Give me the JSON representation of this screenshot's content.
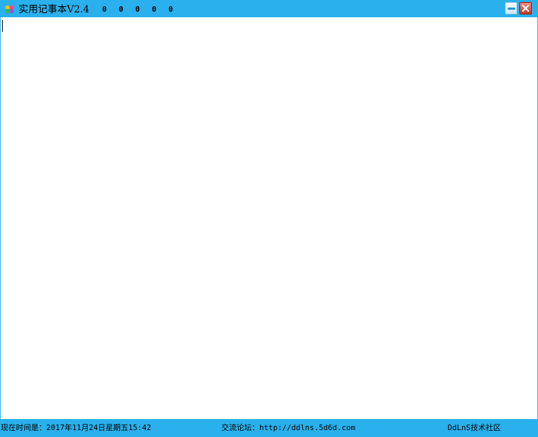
{
  "window": {
    "title": "实用记事本V2.4",
    "menu_items": [
      "0",
      "0",
      "0",
      "0",
      "0"
    ],
    "accent_color": "#2ab0ec",
    "icons": {
      "app": "app-logo-icon",
      "minimize": "minimize-icon",
      "close": "close-icon"
    }
  },
  "editor": {
    "content": ""
  },
  "statusbar": {
    "time_label": "现在时间是：2017年11月24日星期五15:42",
    "forum_label": "交流论坛：http://ddlns.5d6d.com",
    "community_label": "DdLnS技术社区"
  }
}
